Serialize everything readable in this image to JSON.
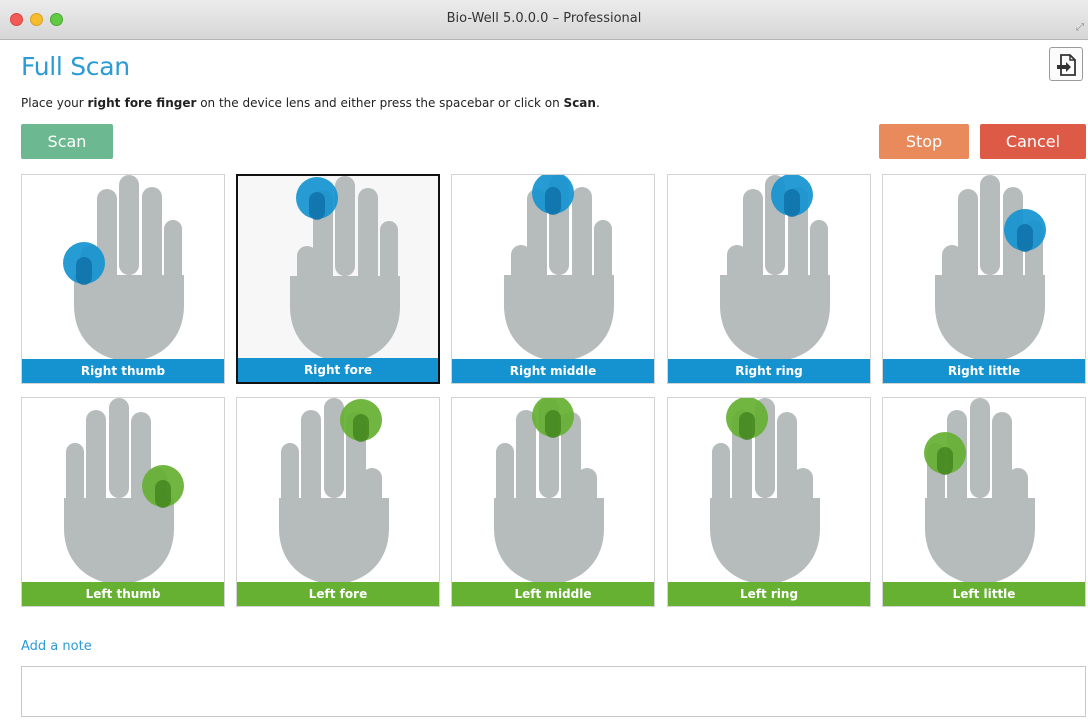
{
  "window": {
    "title": "Bio-Well 5.0.0.0 – Professional"
  },
  "page": {
    "title": "Full Scan",
    "instruction_prefix": "Place your ",
    "instruction_finger": "right fore finger",
    "instruction_middle": " on the device lens and either press the spacebar or click on ",
    "instruction_action": "Scan",
    "instruction_suffix": "."
  },
  "buttons": {
    "scan": "Scan",
    "stop": "Stop",
    "cancel": "Cancel"
  },
  "colors": {
    "right_hand": "#1593d0",
    "left_hand": "#66b032",
    "scan_button": "#6cb890",
    "stop_button": "#e88a5b",
    "cancel_button": "#dd5a46",
    "title": "#2a9bd6"
  },
  "fingers": {
    "right": [
      {
        "label": "Right thumb",
        "finger": "thumb"
      },
      {
        "label": "Right fore",
        "finger": "fore",
        "selected": true
      },
      {
        "label": "Right middle",
        "finger": "middle"
      },
      {
        "label": "Right ring",
        "finger": "ring"
      },
      {
        "label": "Right little",
        "finger": "little"
      }
    ],
    "left": [
      {
        "label": "Left thumb",
        "finger": "thumb"
      },
      {
        "label": "Left fore",
        "finger": "fore"
      },
      {
        "label": "Left middle",
        "finger": "middle"
      },
      {
        "label": "Left ring",
        "finger": "ring"
      },
      {
        "label": "Left little",
        "finger": "little"
      }
    ]
  },
  "note": {
    "link": "Add a note",
    "value": ""
  },
  "icons": {
    "export": "export-icon",
    "resize": "resize-icon"
  }
}
